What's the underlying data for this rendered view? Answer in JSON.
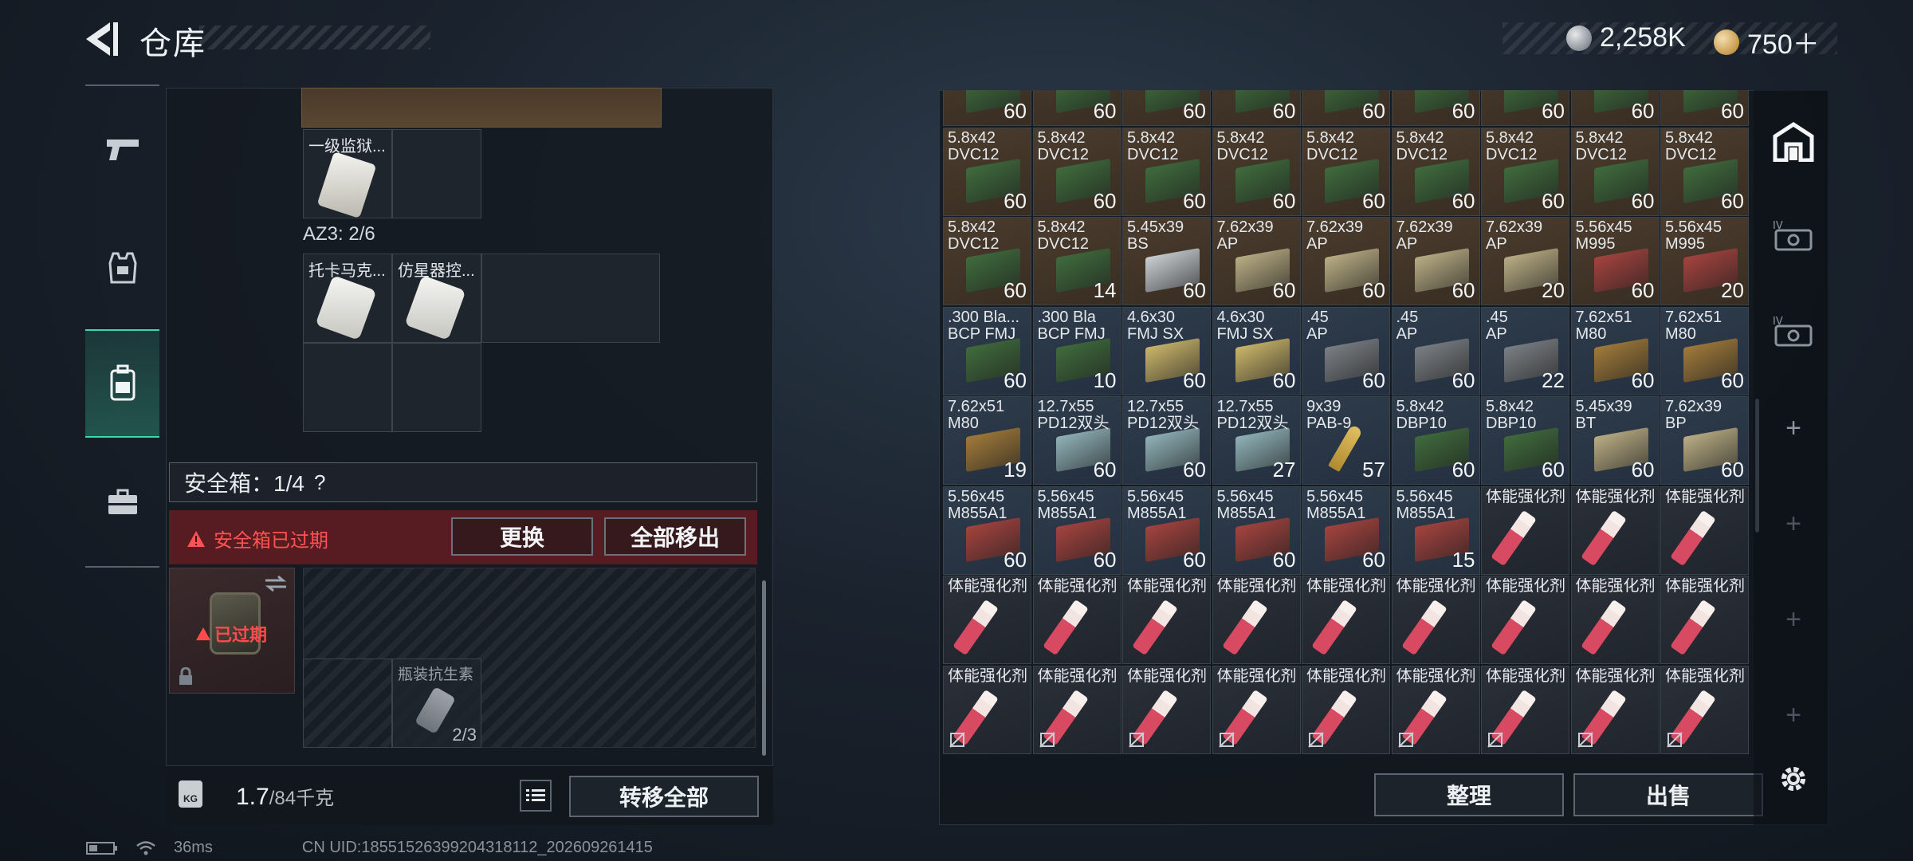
{
  "header": {
    "title": "仓库",
    "currency": [
      {
        "icon": "silver-coin-icon",
        "value": "2,258K"
      },
      {
        "icon": "gold-coin-icon",
        "value": "750＋"
      }
    ]
  },
  "side_nav": [
    {
      "icon": "pistol-icon"
    },
    {
      "icon": "armor-icon"
    },
    {
      "icon": "backpack-icon",
      "active": true
    },
    {
      "icon": "briefcase-icon"
    }
  ],
  "left": {
    "item_1": "一级监狱...",
    "section_az3": "AZ3: 2/6",
    "item_2": "托卡马克...",
    "item_3": "仿星器控...",
    "safe_box_label": "安全箱：1/4",
    "safe_box_help": "?",
    "safe_expired_warning": "安全箱已过期",
    "replace_button": "更换",
    "move_all_out_button": "全部移出",
    "safe_expired_badge": "已过期",
    "safe_item_name": "瓶装抗生素",
    "safe_item_qty": "2/3",
    "weight_value": "1.7",
    "weight_total": "/84千克",
    "weight_icon_text": "KG",
    "transfer_all_button": "转移全部"
  },
  "right": {
    "organize_button": "整理",
    "sell_button": "出售",
    "rail": [
      "home-icon",
      "case-iv-icon",
      "case-iv-icon-2",
      "plus-icon",
      "plus-icon-2",
      "plus-icon-3",
      "plus-icon-4",
      "settings-icon"
    ]
  },
  "inventory_rows": [
    [
      {
        "n": "",
        "q": "60",
        "s": "green",
        "bg": "brown"
      },
      {
        "n": "",
        "q": "60",
        "s": "green",
        "bg": "brown"
      },
      {
        "n": "",
        "q": "60",
        "s": "green",
        "bg": "brown"
      },
      {
        "n": "",
        "q": "60",
        "s": "green",
        "bg": "brown"
      },
      {
        "n": "",
        "q": "60",
        "s": "green",
        "bg": "brown"
      },
      {
        "n": "",
        "q": "60",
        "s": "green",
        "bg": "brown"
      },
      {
        "n": "",
        "q": "60",
        "s": "green",
        "bg": "brown"
      },
      {
        "n": "",
        "q": "60",
        "s": "green",
        "bg": "brown"
      },
      {
        "n": "",
        "q": "60",
        "s": "green",
        "bg": "brown"
      }
    ],
    [
      {
        "n": "5.8x42\nDVC12",
        "q": "60",
        "s": "green",
        "bg": "brown"
      },
      {
        "n": "5.8x42\nDVC12",
        "q": "60",
        "s": "green",
        "bg": "brown"
      },
      {
        "n": "5.8x42\nDVC12",
        "q": "60",
        "s": "green",
        "bg": "brown"
      },
      {
        "n": "5.8x42\nDVC12",
        "q": "60",
        "s": "green",
        "bg": "brown"
      },
      {
        "n": "5.8x42\nDVC12",
        "q": "60",
        "s": "green",
        "bg": "brown"
      },
      {
        "n": "5.8x42\nDVC12",
        "q": "60",
        "s": "green",
        "bg": "brown"
      },
      {
        "n": "5.8x42\nDVC12",
        "q": "60",
        "s": "green",
        "bg": "brown"
      },
      {
        "n": "5.8x42\nDVC12",
        "q": "60",
        "s": "green",
        "bg": "brown"
      },
      {
        "n": "5.8x42\nDVC12",
        "q": "60",
        "s": "green",
        "bg": "brown"
      }
    ],
    [
      {
        "n": "5.8x42\nDVC12",
        "q": "60",
        "s": "green",
        "bg": "brown"
      },
      {
        "n": "5.8x42\nDVC12",
        "q": "14",
        "s": "green",
        "bg": "brown"
      },
      {
        "n": "5.45x39\nBS",
        "q": "60",
        "s": "white",
        "bg": "brown"
      },
      {
        "n": "7.62x39\nAP",
        "q": "60",
        "s": "tan",
        "bg": "brown"
      },
      {
        "n": "7.62x39\nAP",
        "q": "60",
        "s": "tan",
        "bg": "brown"
      },
      {
        "n": "7.62x39\nAP",
        "q": "60",
        "s": "tan",
        "bg": "brown"
      },
      {
        "n": "7.62x39\nAP",
        "q": "20",
        "s": "tan",
        "bg": "brown"
      },
      {
        "n": "5.56x45\nM995",
        "q": "60",
        "s": "red",
        "bg": "brown"
      },
      {
        "n": "5.56x45\nM995",
        "q": "20",
        "s": "red",
        "bg": "brown"
      }
    ],
    [
      {
        "n": ".300 Bla...\nBCP FMJ",
        "q": "60",
        "s": "green",
        "bg": "blue"
      },
      {
        "n": ".300 Bla\nBCP FMJ",
        "q": "10",
        "s": "green",
        "bg": "blue"
      },
      {
        "n": "4.6x30\nFMJ SX",
        "q": "60",
        "s": "yellow",
        "bg": "blue"
      },
      {
        "n": "4.6x30\nFMJ SX",
        "q": "60",
        "s": "yellow",
        "bg": "blue"
      },
      {
        "n": ".45\nAP",
        "q": "60",
        "s": "gray",
        "bg": "blue"
      },
      {
        "n": ".45\nAP",
        "q": "60",
        "s": "gray",
        "bg": "blue"
      },
      {
        "n": ".45\nAP",
        "q": "22",
        "s": "gray",
        "bg": "blue"
      },
      {
        "n": "7.62x51\nM80",
        "q": "60",
        "s": "wood",
        "bg": "blue"
      },
      {
        "n": "7.62x51\nM80",
        "q": "60",
        "s": "wood",
        "bg": "blue"
      }
    ],
    [
      {
        "n": "7.62x51\nM80",
        "q": "19",
        "s": "wood",
        "bg": "blue"
      },
      {
        "n": "12.7x55\nPD12双头",
        "q": "60",
        "s": "teal",
        "bg": "blue"
      },
      {
        "n": "12.7x55\nPD12双头",
        "q": "60",
        "s": "teal",
        "bg": "blue"
      },
      {
        "n": "12.7x55\nPD12双头",
        "q": "27",
        "s": "teal",
        "bg": "blue"
      },
      {
        "n": "9x39\nPAB-9",
        "q": "57",
        "s": "bullet",
        "bg": "blue"
      },
      {
        "n": "5.8x42\nDBP10",
        "q": "60",
        "s": "green",
        "bg": "blue"
      },
      {
        "n": "5.8x42\nDBP10",
        "q": "60",
        "s": "green",
        "bg": "blue"
      },
      {
        "n": "5.45x39\nBT",
        "q": "60",
        "s": "tan",
        "bg": "blue"
      },
      {
        "n": "7.62x39\nBP",
        "q": "60",
        "s": "tan",
        "bg": "blue"
      }
    ],
    [
      {
        "n": "5.56x45\nM855A1",
        "q": "60",
        "s": "red",
        "bg": "blue"
      },
      {
        "n": "5.56x45\nM855A1",
        "q": "60",
        "s": "red",
        "bg": "blue"
      },
      {
        "n": "5.56x45\nM855A1",
        "q": "60",
        "s": "red",
        "bg": "blue"
      },
      {
        "n": "5.56x45\nM855A1",
        "q": "60",
        "s": "red",
        "bg": "blue"
      },
      {
        "n": "5.56x45\nM855A1",
        "q": "60",
        "s": "red",
        "bg": "blue"
      },
      {
        "n": "5.56x45\nM855A1",
        "q": "15",
        "s": "red",
        "bg": "blue"
      },
      {
        "n": "体能强化剂",
        "q": "",
        "s": "stim",
        "bg": "dark"
      },
      {
        "n": "体能强化剂",
        "q": "",
        "s": "stim",
        "bg": "dark"
      },
      {
        "n": "体能强化剂",
        "q": "",
        "s": "stim",
        "bg": "dark"
      }
    ],
    [
      {
        "n": "体能强化剂",
        "q": "",
        "s": "stim",
        "bg": "dark"
      },
      {
        "n": "体能强化剂",
        "q": "",
        "s": "stim",
        "bg": "dark"
      },
      {
        "n": "体能强化剂",
        "q": "",
        "s": "stim",
        "bg": "dark"
      },
      {
        "n": "体能强化剂",
        "q": "",
        "s": "stim",
        "bg": "dark"
      },
      {
        "n": "体能强化剂",
        "q": "",
        "s": "stim",
        "bg": "dark"
      },
      {
        "n": "体能强化剂",
        "q": "",
        "s": "stim",
        "bg": "dark"
      },
      {
        "n": "体能强化剂",
        "q": "",
        "s": "stim",
        "bg": "dark"
      },
      {
        "n": "体能强化剂",
        "q": "",
        "s": "stim",
        "bg": "dark"
      },
      {
        "n": "体能强化剂",
        "q": "",
        "s": "stim",
        "bg": "dark"
      }
    ],
    [
      {
        "n": "体能强化剂",
        "q": "",
        "s": "stim",
        "bg": "dark",
        "locked": true
      },
      {
        "n": "体能强化剂",
        "q": "",
        "s": "stim",
        "bg": "dark",
        "locked": true
      },
      {
        "n": "体能强化剂",
        "q": "",
        "s": "stim",
        "bg": "dark",
        "locked": true
      },
      {
        "n": "体能强化剂",
        "q": "",
        "s": "stim",
        "bg": "dark",
        "locked": true
      },
      {
        "n": "体能强化剂",
        "q": "",
        "s": "stim",
        "bg": "dark",
        "locked": true
      },
      {
        "n": "体能强化剂",
        "q": "",
        "s": "stim",
        "bg": "dark",
        "locked": true
      },
      {
        "n": "体能强化剂",
        "q": "",
        "s": "stim",
        "bg": "dark",
        "locked": true
      },
      {
        "n": "体能强化剂",
        "q": "",
        "s": "stim",
        "bg": "dark",
        "locked": true
      },
      {
        "n": "体能强化剂",
        "q": "",
        "s": "stim",
        "bg": "dark",
        "locked": true
      }
    ]
  ],
  "ammo_colors": {
    "green": "#3f6b3c",
    "white": "#c9cfd2",
    "tan": "#b9ad84",
    "red": "#a4433e",
    "yellow": "#c9b56a",
    "gray": "#7a7f84",
    "wood": "#a07a3a",
    "teal": "#8fb2b8"
  },
  "status": {
    "ping": "36ms",
    "uid": "CN UID:18551526399204318112_202609261415"
  }
}
